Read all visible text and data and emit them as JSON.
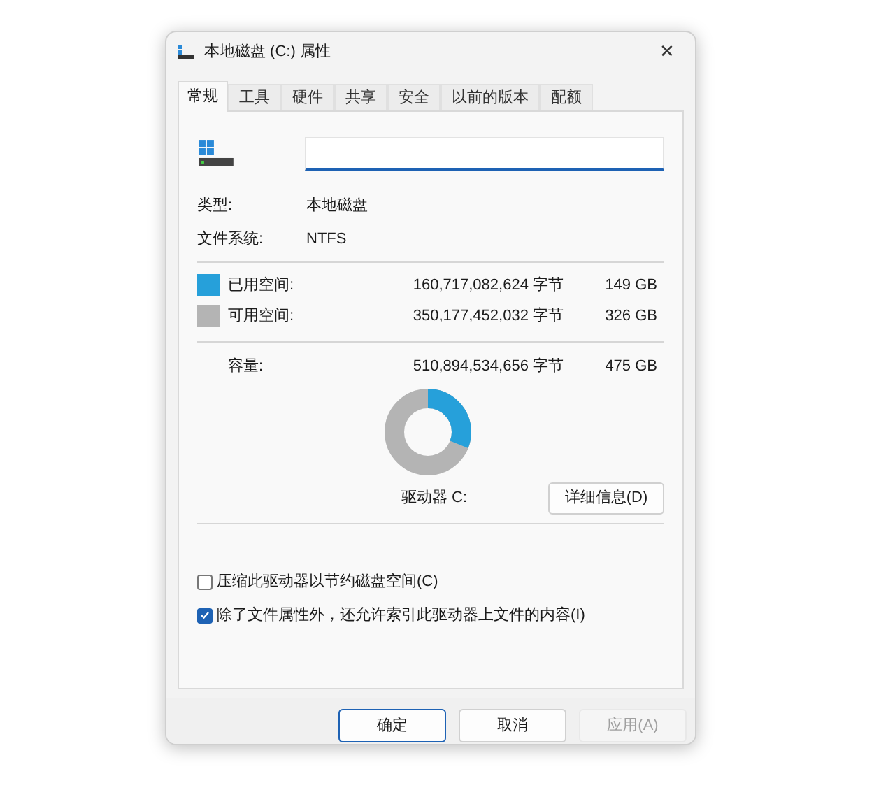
{
  "window": {
    "title": "本地磁盘 (C:) 属性",
    "close": "✕"
  },
  "tabs": [
    {
      "label": "常规",
      "selected": true
    },
    {
      "label": "工具",
      "selected": false
    },
    {
      "label": "硬件",
      "selected": false
    },
    {
      "label": "共享",
      "selected": false
    },
    {
      "label": "安全",
      "selected": false
    },
    {
      "label": "以前的版本",
      "selected": false
    },
    {
      "label": "配额",
      "selected": false
    }
  ],
  "info": [
    {
      "label": "类型:",
      "value": "本地磁盘"
    },
    {
      "label": "文件系统:",
      "value": "NTFS"
    }
  ],
  "space": [
    {
      "label": "已用空间:",
      "bytes": "160,717,082,624 字节",
      "size": "149 GB",
      "color": "#26a0da"
    },
    {
      "label": "可用空间:",
      "bytes": "350,177,452,032 字节",
      "size": "326 GB",
      "color": "#b4b4b4"
    }
  ],
  "capacity": {
    "label": "容量:",
    "bytes": "510,894,534,656 字节",
    "size": "475 GB"
  },
  "drive_label": "驱动器 C:",
  "details_button": "详细信息(D)",
  "options": [
    {
      "label": "压缩此驱动器以节约磁盘空间(C)",
      "checked": false
    },
    {
      "label": "除了文件属性外，还允许索引此驱动器上文件的内容(I)",
      "checked": true
    }
  ],
  "buttons": [
    {
      "label": "确定",
      "disabled": false,
      "default": true
    },
    {
      "label": "取消",
      "disabled": false,
      "default": false
    },
    {
      "label": "应用(A)",
      "disabled": true,
      "default": false
    }
  ]
}
